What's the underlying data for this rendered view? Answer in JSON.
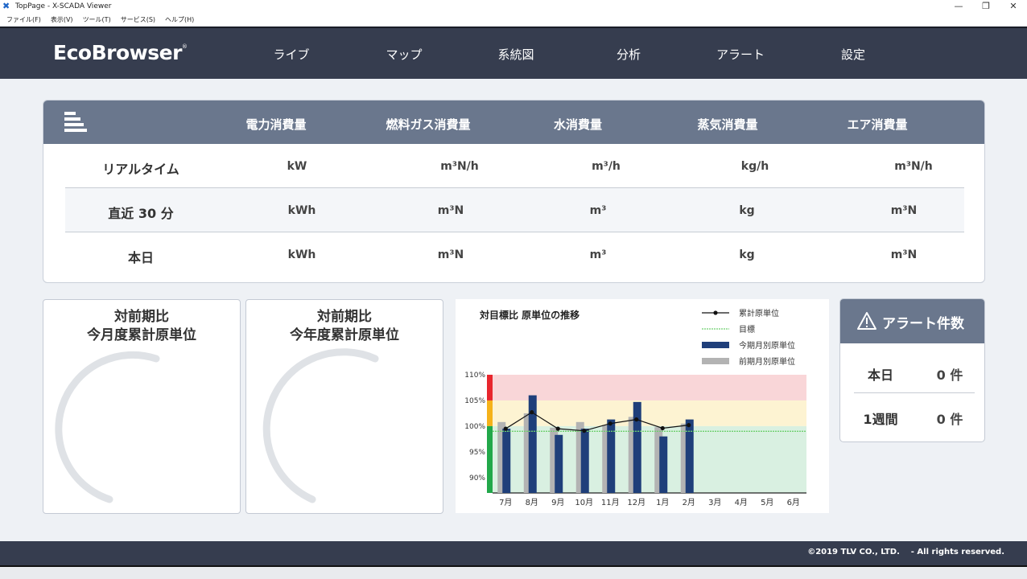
{
  "window": {
    "title": "TopPage - X-SCADA Viewer",
    "app_icon": "x-icon",
    "controls": [
      "—",
      "❐",
      "✕"
    ]
  },
  "menubar": [
    "ファイル(F)",
    "表示(V)",
    "ツール(T)",
    "サービス(S)",
    "ヘルプ(H)"
  ],
  "nav": {
    "logo": "EcoBrowser",
    "logo_mark": "®",
    "items": [
      "ライブ",
      "マップ",
      "系統図",
      "分析",
      "アラート",
      "設定"
    ]
  },
  "summary": {
    "icon": "list-icon",
    "columns": [
      "電力消費量",
      "燃料ガス消費量",
      "水消費量",
      "蒸気消費量",
      "エア消費量"
    ],
    "rows": [
      {
        "label": "リアルタイム",
        "values": [
          "kW",
          "m³N/h",
          "m³/h",
          "kg/h",
          "m³N/h"
        ]
      },
      {
        "label": "直近 30 分",
        "values": [
          "kWh",
          "m³N",
          "m³",
          "kg",
          "m³N"
        ]
      },
      {
        "label": "本日",
        "values": [
          "kWh",
          "m³N",
          "m³",
          "kg",
          "m³N"
        ]
      }
    ]
  },
  "gauges": [
    {
      "line1": "対前期比",
      "line2": "今月度累計原単位"
    },
    {
      "line1": "対前期比",
      "line2": "今年度累計原単位"
    }
  ],
  "chart_data": {
    "type": "bar",
    "title": "対目標比 原単位の推移",
    "categories": [
      "7月",
      "8月",
      "9月",
      "10月",
      "11月",
      "12月",
      "1月",
      "2月",
      "3月",
      "4月",
      "5月",
      "6月"
    ],
    "series": [
      {
        "name": "今期月別原単位",
        "type": "bar",
        "color": "#1f3f7a",
        "values": [
          99.5,
          106,
          98.3,
          99.5,
          101.3,
          104.7,
          98,
          101.3,
          null,
          null,
          null,
          null
        ]
      },
      {
        "name": "前期月別原単位",
        "type": "bar",
        "color": "#b3b3b3",
        "values": [
          100.8,
          102.5,
          99.7,
          100.8,
          100.2,
          101.8,
          99.8,
          100.5,
          null,
          null,
          null,
          null
        ]
      },
      {
        "name": "累計原単位",
        "type": "line",
        "color": "#111111",
        "values": [
          99.5,
          102.7,
          99.5,
          99.1,
          100.5,
          101.3,
          99.6,
          100.2,
          null,
          null,
          null,
          null
        ]
      },
      {
        "name": "目標",
        "type": "line",
        "color": "#6fcf6f",
        "values": [
          99.0,
          99.0,
          99.0,
          99.0,
          99.0,
          99.0,
          99.0,
          99.0,
          99.0,
          99.0,
          99.0,
          99.0
        ]
      }
    ],
    "yticks": [
      "110%",
      "105%",
      "100%",
      "95%",
      "90%"
    ],
    "ylim": [
      87,
      110
    ],
    "bands": [
      {
        "from": 105,
        "to": 110,
        "color": "#f9d6d8"
      },
      {
        "from": 100,
        "to": 105,
        "color": "#fdf3d2"
      },
      {
        "from": 87,
        "to": 100,
        "color": "#d9f0e1"
      }
    ],
    "side_bands": [
      {
        "from": 105,
        "to": 110,
        "color": "#e8262d"
      },
      {
        "from": 100,
        "to": 105,
        "color": "#f5b21a"
      },
      {
        "from": 87,
        "to": 100,
        "color": "#22a84a"
      }
    ],
    "legend_position": "top-right",
    "grid": false
  },
  "alerts": {
    "title": "アラート件数",
    "icon": "warning-icon",
    "rows": [
      {
        "label": "本日",
        "value": "0 件"
      },
      {
        "label": "1週間",
        "value": "0 件"
      }
    ]
  },
  "footer": {
    "copyright": "©2019 TLV CO., LTD.    - All rights reserved."
  }
}
